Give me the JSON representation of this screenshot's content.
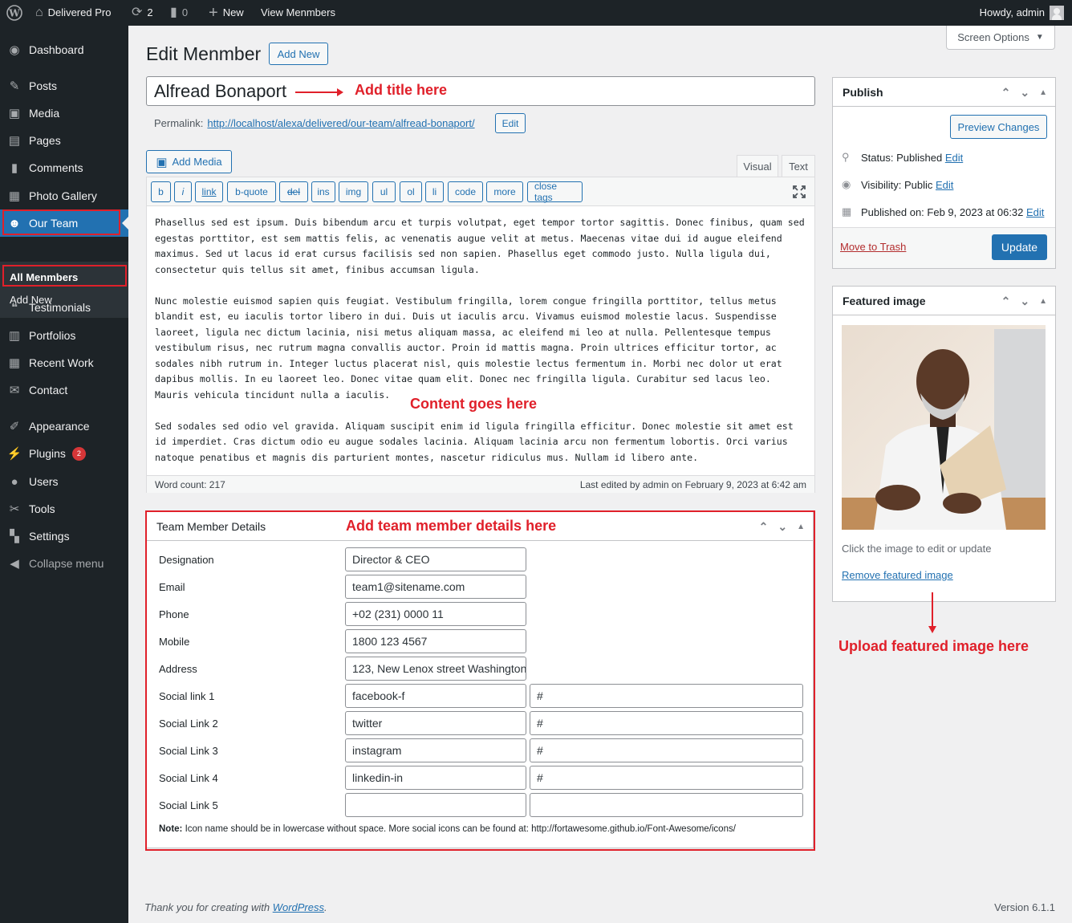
{
  "adminbar": {
    "site_name": "Delivered Pro",
    "updates_count": "2",
    "comments_count": "0",
    "new_label": "New",
    "view_label": "View Menmbers",
    "howdy": "Howdy, admin"
  },
  "sidebar": {
    "items": [
      {
        "label": "Dashboard",
        "icon": "dashboard-icon"
      },
      {
        "label": "Posts",
        "icon": "pin-icon"
      },
      {
        "label": "Media",
        "icon": "media-icon"
      },
      {
        "label": "Pages",
        "icon": "pages-icon"
      },
      {
        "label": "Comments",
        "icon": "comment-icon"
      },
      {
        "label": "Photo Gallery",
        "icon": "gallery-icon"
      },
      {
        "label": "Our Team",
        "icon": "team-icon"
      },
      {
        "label": "Testimonials",
        "icon": "quote-icon"
      },
      {
        "label": "Portfolios",
        "icon": "portfolio-icon"
      },
      {
        "label": "Recent Work",
        "icon": "calendar-icon"
      },
      {
        "label": "Contact",
        "icon": "mail-icon"
      },
      {
        "label": "Appearance",
        "icon": "brush-icon"
      },
      {
        "label": "Plugins",
        "icon": "plugin-icon",
        "badge": "2"
      },
      {
        "label": "Users",
        "icon": "user-icon"
      },
      {
        "label": "Tools",
        "icon": "wrench-icon"
      },
      {
        "label": "Settings",
        "icon": "settings-icon"
      },
      {
        "label": "Collapse menu",
        "icon": "collapse-icon"
      }
    ],
    "submenu": {
      "all_label": "All Menmbers",
      "add_new_label": "Add New"
    }
  },
  "screen_options": "Screen Options",
  "page": {
    "title": "Edit Menmber",
    "add_new": "Add New",
    "post_title": "Alfread Bonaport",
    "permalink_label": "Permalink:",
    "permalink_base": "http://localhost/alexa/delivered/our-team/",
    "permalink_slug": "alfread-bonaport",
    "permalink_end": "/",
    "edit_label": "Edit"
  },
  "editor": {
    "add_media": "Add Media",
    "tab_visual": "Visual",
    "tab_text": "Text",
    "quicktags": [
      "b",
      "i",
      "link",
      "b-quote",
      "del",
      "ins",
      "img",
      "ul",
      "ol",
      "li",
      "code",
      "more",
      "close tags"
    ],
    "paragraphs": [
      "Phasellus sed est ipsum. Duis bibendum arcu et turpis volutpat, eget tempor tortor sagittis. Donec finibus, quam sed\negestas porttitor, est sem mattis felis, ac venenatis augue velit at metus. Maecenas vitae dui id augue eleifend\nmaximus. Sed ut lacus id erat cursus facilisis sed non sapien. Phasellus eget commodo justo. Nulla ligula dui,\nconsectetur quis tellus sit amet, finibus accumsan ligula.",
      "Nunc molestie euismod sapien quis feugiat. Vestibulum fringilla, lorem congue fringilla porttitor, tellus metus\nblandit est, eu iaculis tortor libero in dui. Duis ut iaculis arcu. Vivamus euismod molestie lacus. Suspendisse\nlaoreet, ligula nec dictum lacinia, nisi metus aliquam massa, ac eleifend mi leo at nulla. Pellentesque tempus\nvestibulum risus, nec rutrum magna convallis auctor. Proin id mattis magna. Proin ultrices efficitur tortor, ac\nsodales nibh rutrum in. Integer luctus placerat nisl, quis molestie lectus fermentum in. Morbi nec dolor ut erat\ndapibus mollis. In eu laoreet leo. Donec vitae quam elit. Donec nec fringilla ligula. Curabitur sed lacus leo.\nMauris vehicula tincidunt nulla a iaculis.",
      "Sed sodales sed odio vel gravida. Aliquam suscipit enim id ligula fringilla efficitur. Donec molestie sit amet est\nid imperdiet. Cras dictum odio eu augue sodales lacinia. Aliquam lacinia arcu non fermentum lobortis. Orci varius\nnatoque penatibus et magnis dis parturient montes, nascetur ridiculus mus. Nullam id libero ante."
    ],
    "word_count": "Word count: 217",
    "last_edited": "Last edited by admin on February 9, 2023 at 6:42 am"
  },
  "details": {
    "title": "Team Member Details",
    "fields": [
      {
        "label": "Designation",
        "value": "Director & CEO"
      },
      {
        "label": "Email",
        "value": "team1@sitename.com"
      },
      {
        "label": "Phone",
        "value": "+02 (231) 0000 11"
      },
      {
        "label": "Mobile",
        "value": "1800 123 4567"
      },
      {
        "label": "Address",
        "value": "123, New Lenox street Washington"
      }
    ],
    "social": [
      {
        "label": "Social link 1",
        "icon": "facebook-f",
        "url": "#"
      },
      {
        "label": "Social Link 2",
        "icon": "twitter",
        "url": "#"
      },
      {
        "label": "Social Link 3",
        "icon": "instagram",
        "url": "#"
      },
      {
        "label": "Social Link 4",
        "icon": "linkedin-in",
        "url": "#"
      },
      {
        "label": "Social Link 5",
        "icon": "",
        "url": ""
      }
    ],
    "note_bold": "Note:",
    "note_text": "Icon name should be in lowercase without space. More social icons can be found at: http://fortawesome.github.io/Font-Awesome/icons/"
  },
  "publish": {
    "title": "Publish",
    "preview": "Preview Changes",
    "status_label": "Status: ",
    "status_value": "Published",
    "visibility_label": "Visibility: ",
    "visibility_value": "Public",
    "published_label": "Published on: ",
    "published_value": "Feb 9, 2023 at 06:32",
    "edit": "Edit",
    "trash": "Move to Trash",
    "update": "Update"
  },
  "featured": {
    "title": "Featured image",
    "help": "Click the image to edit or update",
    "remove": "Remove featured image"
  },
  "annotations": {
    "title": "Add title here",
    "content": "Content goes here",
    "details": "Add team member details here",
    "featured": "Upload featured image here"
  },
  "footer": {
    "thanks": "Thank you for creating with ",
    "wp": "WordPress",
    "period": ".",
    "version": "Version 6.1.1"
  },
  "colors": {
    "accent": "#2271b1",
    "annotation": "#e0202a",
    "adminbar": "#1d2327"
  }
}
